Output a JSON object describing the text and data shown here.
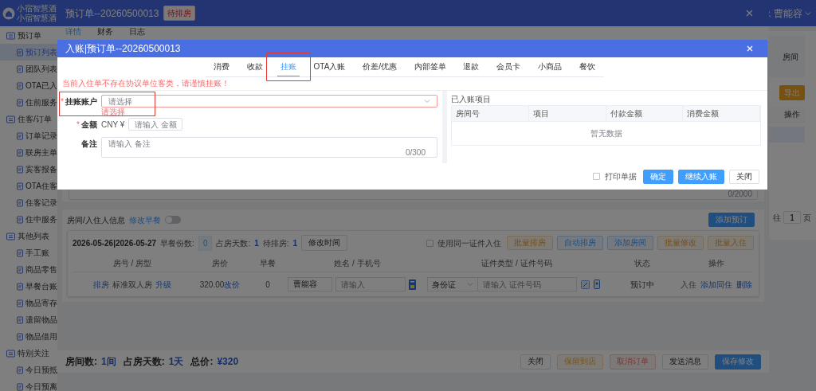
{
  "app": {
    "brand_lines": [
      "小宿智慧酒",
      "小宿智慧酒"
    ],
    "user": "曹能容"
  },
  "sidebar": [
    {
      "label": "预订单",
      "children": [
        {
          "label": "预订列表",
          "selected": true
        },
        {
          "label": "团队列表",
          "selected": false
        },
        {
          "label": "OTA已入",
          "selected": false
        },
        {
          "label": "住前服务",
          "selected": false
        }
      ]
    },
    {
      "label": "住客/订单",
      "children": [
        {
          "label": "订单记录",
          "selected": false
        },
        {
          "label": "联房主单",
          "selected": false
        },
        {
          "label": "宾客报备",
          "selected": false
        },
        {
          "label": "OTA住客",
          "selected": false
        },
        {
          "label": "住客记录",
          "selected": false
        },
        {
          "label": "住中服务",
          "selected": false
        }
      ]
    },
    {
      "label": "其他列表",
      "children": [
        {
          "label": "手工账",
          "selected": false
        },
        {
          "label": "商品零售",
          "selected": false
        },
        {
          "label": "早餐台账",
          "selected": false
        },
        {
          "label": "物品寄存",
          "selected": false
        },
        {
          "label": "遗留物品",
          "selected": false
        },
        {
          "label": "物品借用",
          "selected": false
        }
      ]
    },
    {
      "label": "特别关注",
      "children": [
        {
          "label": "今日预抵",
          "selected": false
        },
        {
          "label": "今日预离",
          "selected": false
        }
      ]
    }
  ],
  "main_page": {
    "card_text": "房间",
    "export_button": "导出",
    "table_header": "操作",
    "pager": {
      "prefix": "往",
      "page": "1",
      "suffix": "页"
    }
  },
  "drawer": {
    "title": "预订单--20260500013",
    "badge": "待排房",
    "tabs": [
      {
        "label": "详情",
        "selected": true
      },
      {
        "label": "财务",
        "selected": false
      },
      {
        "label": "日志",
        "selected": false
      }
    ],
    "remark_counter": "0/2000",
    "rooms_section": {
      "title": "房间/入住人信息",
      "edit_breakfast": "修改早餐",
      "breakfast_toggle_on": false,
      "add_button": "添加预订",
      "date_range": "2026-05-26|2026-05-27",
      "breakfast_count_label": "早餐份数:",
      "breakfast_count": "0",
      "days_label": "占房天数:",
      "days": "1",
      "pending_label": "待排房:",
      "pending": "1",
      "change_time_button": "修改时间",
      "same_id": {
        "label": "使用同一证件入住",
        "checked": false
      },
      "actions": [
        {
          "label": "批量排房",
          "kind": "plain-warning"
        },
        {
          "label": "自动排房",
          "kind": "plain-primary"
        },
        {
          "label": "添加房间",
          "kind": "plain-primary"
        },
        {
          "label": "批量修改",
          "kind": "plain-warning"
        },
        {
          "label": "批量入住",
          "kind": "plain-warning"
        }
      ],
      "columns": [
        "房号 / 房型",
        "房价",
        "早餐",
        "姓名 / 手机号",
        "证件类型 / 证件号码",
        "状态",
        "操作"
      ],
      "rows": [
        {
          "assign_link": "排房",
          "room_type": "标准双人房",
          "upgrade_link": "升级",
          "price": "320.00",
          "change_price_link": "改价",
          "breakfast": "0",
          "name": "曹能容",
          "phone_placeholder": "请输入",
          "id_type": "身份证",
          "id_placeholder": "请输入 证件号码",
          "status": "预订中",
          "ops": [
            {
              "label": "入住",
              "kind": "muted"
            },
            {
              "label": "添加同住",
              "kind": "link"
            },
            {
              "label": "删除",
              "kind": "link"
            }
          ]
        }
      ]
    },
    "footer": {
      "summary": [
        {
          "label": "房间数:",
          "value": "1间"
        },
        {
          "label": "占房天数:",
          "value": "1天"
        },
        {
          "label": "总价:",
          "value": "¥320"
        }
      ],
      "buttons": [
        {
          "label": "关闭",
          "kind": "default"
        },
        {
          "label": "保留到店",
          "kind": "plain-warning"
        },
        {
          "label": "取消订单",
          "kind": "plain-danger"
        },
        {
          "label": "发送消息",
          "kind": "default"
        },
        {
          "label": "保存修改",
          "kind": "primary"
        }
      ]
    }
  },
  "modal": {
    "title": "入账|预订单--20260500013",
    "tabs": [
      {
        "label": "消费",
        "selected": false,
        "highlighted": false
      },
      {
        "label": "收款",
        "selected": false,
        "highlighted": false
      },
      {
        "label": "挂账",
        "selected": true,
        "highlighted": true
      },
      {
        "label": "OTA入账",
        "selected": false,
        "highlighted": false
      },
      {
        "label": "价差/优惠",
        "selected": false,
        "highlighted": false
      },
      {
        "label": "内部签单",
        "selected": false,
        "highlighted": false
      },
      {
        "label": "退款",
        "selected": false,
        "highlighted": false
      },
      {
        "label": "会员卡",
        "selected": false,
        "highlighted": false
      },
      {
        "label": "小商品",
        "selected": false,
        "highlighted": false
      },
      {
        "label": "餐饮",
        "selected": false,
        "highlighted": false
      }
    ],
    "warning": "当前入住单不存在协议单位客类，请谨慎挂账！",
    "form": {
      "account": {
        "label": "挂账账户",
        "required_mark": "*",
        "placeholder": "请选择",
        "error": "请选择",
        "highlighted": true
      },
      "amount": {
        "label": "金额",
        "required_mark": "*",
        "currency": "CNY ¥",
        "placeholder": "请输入 金额"
      },
      "note": {
        "label": "备注",
        "placeholder": "请输入 备注",
        "counter": "0/300"
      }
    },
    "posted": {
      "title": "已入账项目",
      "columns": [
        "房间号",
        "项目",
        "付款金额",
        "消费金额"
      ],
      "empty": "暂无数据"
    },
    "print_receipt": {
      "label": "打印单据",
      "checked": false
    },
    "buttons": [
      {
        "label": "确定",
        "kind": "primary"
      },
      {
        "label": "继续入账",
        "kind": "primary"
      },
      {
        "label": "关闭",
        "kind": "default"
      }
    ]
  }
}
